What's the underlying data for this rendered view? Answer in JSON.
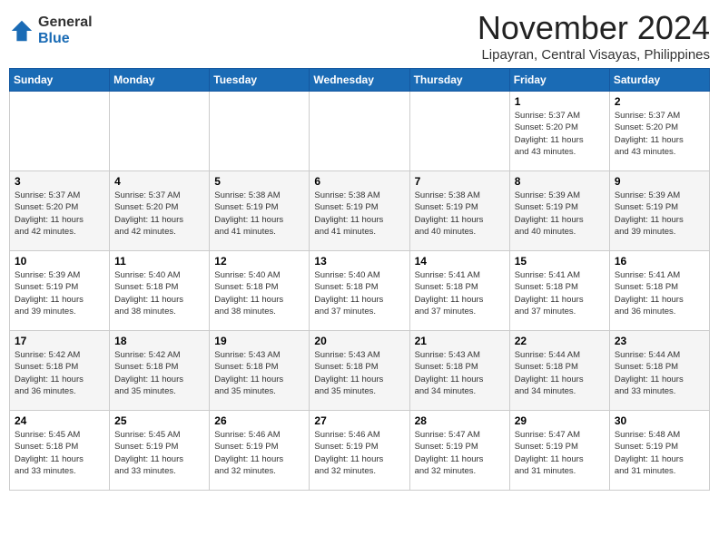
{
  "header": {
    "logo_general": "General",
    "logo_blue": "Blue",
    "month_title": "November 2024",
    "location": "Lipayran, Central Visayas, Philippines"
  },
  "days_of_week": [
    "Sunday",
    "Monday",
    "Tuesday",
    "Wednesday",
    "Thursday",
    "Friday",
    "Saturday"
  ],
  "weeks": [
    [
      {
        "day": "",
        "info": ""
      },
      {
        "day": "",
        "info": ""
      },
      {
        "day": "",
        "info": ""
      },
      {
        "day": "",
        "info": ""
      },
      {
        "day": "",
        "info": ""
      },
      {
        "day": "1",
        "info": "Sunrise: 5:37 AM\nSunset: 5:20 PM\nDaylight: 11 hours\nand 43 minutes."
      },
      {
        "day": "2",
        "info": "Sunrise: 5:37 AM\nSunset: 5:20 PM\nDaylight: 11 hours\nand 43 minutes."
      }
    ],
    [
      {
        "day": "3",
        "info": "Sunrise: 5:37 AM\nSunset: 5:20 PM\nDaylight: 11 hours\nand 42 minutes."
      },
      {
        "day": "4",
        "info": "Sunrise: 5:37 AM\nSunset: 5:20 PM\nDaylight: 11 hours\nand 42 minutes."
      },
      {
        "day": "5",
        "info": "Sunrise: 5:38 AM\nSunset: 5:19 PM\nDaylight: 11 hours\nand 41 minutes."
      },
      {
        "day": "6",
        "info": "Sunrise: 5:38 AM\nSunset: 5:19 PM\nDaylight: 11 hours\nand 41 minutes."
      },
      {
        "day": "7",
        "info": "Sunrise: 5:38 AM\nSunset: 5:19 PM\nDaylight: 11 hours\nand 40 minutes."
      },
      {
        "day": "8",
        "info": "Sunrise: 5:39 AM\nSunset: 5:19 PM\nDaylight: 11 hours\nand 40 minutes."
      },
      {
        "day": "9",
        "info": "Sunrise: 5:39 AM\nSunset: 5:19 PM\nDaylight: 11 hours\nand 39 minutes."
      }
    ],
    [
      {
        "day": "10",
        "info": "Sunrise: 5:39 AM\nSunset: 5:19 PM\nDaylight: 11 hours\nand 39 minutes."
      },
      {
        "day": "11",
        "info": "Sunrise: 5:40 AM\nSunset: 5:18 PM\nDaylight: 11 hours\nand 38 minutes."
      },
      {
        "day": "12",
        "info": "Sunrise: 5:40 AM\nSunset: 5:18 PM\nDaylight: 11 hours\nand 38 minutes."
      },
      {
        "day": "13",
        "info": "Sunrise: 5:40 AM\nSunset: 5:18 PM\nDaylight: 11 hours\nand 37 minutes."
      },
      {
        "day": "14",
        "info": "Sunrise: 5:41 AM\nSunset: 5:18 PM\nDaylight: 11 hours\nand 37 minutes."
      },
      {
        "day": "15",
        "info": "Sunrise: 5:41 AM\nSunset: 5:18 PM\nDaylight: 11 hours\nand 37 minutes."
      },
      {
        "day": "16",
        "info": "Sunrise: 5:41 AM\nSunset: 5:18 PM\nDaylight: 11 hours\nand 36 minutes."
      }
    ],
    [
      {
        "day": "17",
        "info": "Sunrise: 5:42 AM\nSunset: 5:18 PM\nDaylight: 11 hours\nand 36 minutes."
      },
      {
        "day": "18",
        "info": "Sunrise: 5:42 AM\nSunset: 5:18 PM\nDaylight: 11 hours\nand 35 minutes."
      },
      {
        "day": "19",
        "info": "Sunrise: 5:43 AM\nSunset: 5:18 PM\nDaylight: 11 hours\nand 35 minutes."
      },
      {
        "day": "20",
        "info": "Sunrise: 5:43 AM\nSunset: 5:18 PM\nDaylight: 11 hours\nand 35 minutes."
      },
      {
        "day": "21",
        "info": "Sunrise: 5:43 AM\nSunset: 5:18 PM\nDaylight: 11 hours\nand 34 minutes."
      },
      {
        "day": "22",
        "info": "Sunrise: 5:44 AM\nSunset: 5:18 PM\nDaylight: 11 hours\nand 34 minutes."
      },
      {
        "day": "23",
        "info": "Sunrise: 5:44 AM\nSunset: 5:18 PM\nDaylight: 11 hours\nand 33 minutes."
      }
    ],
    [
      {
        "day": "24",
        "info": "Sunrise: 5:45 AM\nSunset: 5:18 PM\nDaylight: 11 hours\nand 33 minutes."
      },
      {
        "day": "25",
        "info": "Sunrise: 5:45 AM\nSunset: 5:19 PM\nDaylight: 11 hours\nand 33 minutes."
      },
      {
        "day": "26",
        "info": "Sunrise: 5:46 AM\nSunset: 5:19 PM\nDaylight: 11 hours\nand 32 minutes."
      },
      {
        "day": "27",
        "info": "Sunrise: 5:46 AM\nSunset: 5:19 PM\nDaylight: 11 hours\nand 32 minutes."
      },
      {
        "day": "28",
        "info": "Sunrise: 5:47 AM\nSunset: 5:19 PM\nDaylight: 11 hours\nand 32 minutes."
      },
      {
        "day": "29",
        "info": "Sunrise: 5:47 AM\nSunset: 5:19 PM\nDaylight: 11 hours\nand 31 minutes."
      },
      {
        "day": "30",
        "info": "Sunrise: 5:48 AM\nSunset: 5:19 PM\nDaylight: 11 hours\nand 31 minutes."
      }
    ]
  ]
}
